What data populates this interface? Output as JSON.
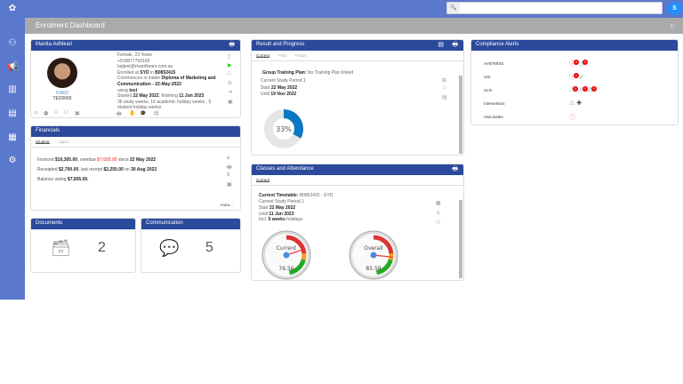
{
  "app": {
    "search_placeholder": "",
    "user_initial": "S"
  },
  "page": {
    "title": "Enrolment Dashboard"
  },
  "student": {
    "name": "Manita Adhikari",
    "id": "51603",
    "code": "TED0665",
    "gender_age": "Female, 23 Years",
    "phone": "+919877769160",
    "email": "baljeet@rtosoftware.com.au",
    "enrolled_prefix": "Enrolled at",
    "campus": "SYD",
    "in": "in",
    "enrol_code": "B0852415",
    "commences_prefix": "Commences in intake",
    "course": "Diploma of Marketing and Communication - 22-May-2022",
    "using_prefix": "using",
    "using": "test",
    "started_prefix": "Started",
    "start": "22 May 2022",
    "finishing_prefix": ", finishing",
    "finish": "11 Jun 2023",
    "weeks": "36 study weeks, 16 academic holiday weeks , 5 student holiday weeks",
    "bottom_letters": [
      "A",
      "U"
    ]
  },
  "financials": {
    "title": "Financials",
    "tabs": [
      "Student",
      "Agent"
    ],
    "invoiced_label": "Invoiced",
    "invoiced": "$10,305.00",
    "overdue_label": ", overdue",
    "overdue": "$7,605.00",
    "since_label": "since",
    "since": "22 May 2022",
    "receipted_label": "Receipted",
    "receipted": "$2,700.00",
    "last_label": ", last receipt",
    "last": "$2,250.00",
    "on_label": "on",
    "on": "30 Aug 2022",
    "balance_label": "Balance owing",
    "balance": "$7,605.00.",
    "more": "more..."
  },
  "documents": {
    "title": "Documents",
    "count": "2"
  },
  "communication": {
    "title": "Communication",
    "count": "5"
  },
  "progress": {
    "title": "Result and Progress",
    "tabs": [
      "Current",
      "Past",
      "Future"
    ],
    "gtp_label": "Group Training Plan:",
    "gtp": "No Training Plan linked",
    "period": "Current Study Period 1",
    "start_label": "Start",
    "start": "22 May 2022",
    "until_label": "Until",
    "until": "19 Nov 2022",
    "percent": 33,
    "percent_label": "33%",
    "color": "#0a78c0"
  },
  "classes": {
    "title": "Classes and Attendance",
    "tabs": [
      "Current"
    ],
    "timetable_label": "Current Timetable:",
    "timetable": "B0852415 - SYD",
    "period": "Current Study Period 1",
    "start_label": "Start",
    "start": "22 May 2022",
    "until_label": "Until",
    "until": "11 Jun 2023",
    "incl_label": "Incl.",
    "incl": "5 weeks",
    "holidays": "holidays",
    "gauges": [
      {
        "label": "Current",
        "value": "76.56"
      },
      {
        "label": "Overall",
        "value": "85.58"
      }
    ]
  },
  "compliance": {
    "title": "Compliance Alerts",
    "rows": [
      {
        "label": "AVETMISS",
        "badges": [
          "0",
          "0"
        ]
      },
      {
        "label": "USI",
        "badges": [
          "1"
        ]
      },
      {
        "label": "ULN",
        "badges": [
          "0",
          "0",
          "0"
        ]
      },
      {
        "label": "Intervention",
        "badges": []
      },
      {
        "label": "Visa Dates",
        "badges": []
      }
    ]
  }
}
